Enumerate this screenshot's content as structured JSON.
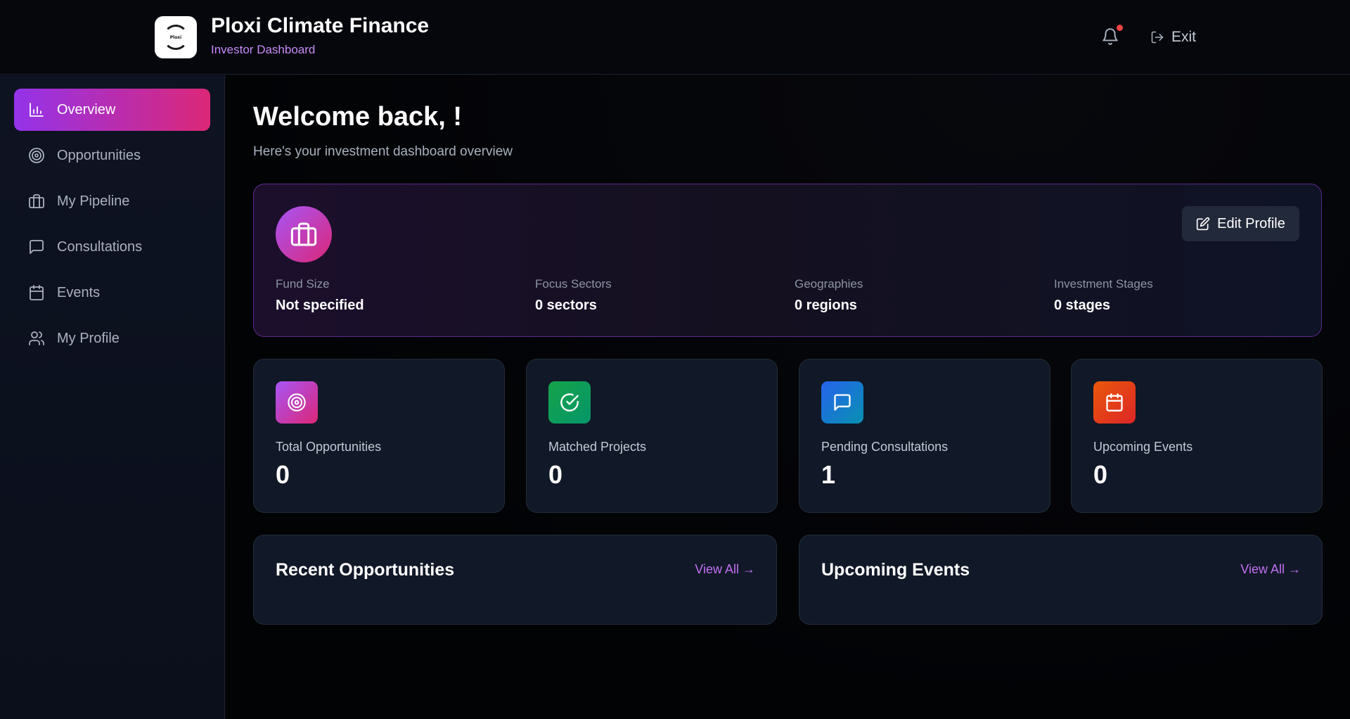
{
  "header": {
    "logo_text": "Ploxi",
    "title": "Ploxi Climate Finance",
    "subtitle": "Investor Dashboard",
    "notification_icon": "bell-icon",
    "exit_label": "Exit"
  },
  "sidebar": {
    "items": [
      {
        "label": "Overview",
        "icon": "bar-chart-icon",
        "active": true
      },
      {
        "label": "Opportunities",
        "icon": "target-icon"
      },
      {
        "label": "My Pipeline",
        "icon": "briefcase-icon"
      },
      {
        "label": "Consultations",
        "icon": "message-square-icon"
      },
      {
        "label": "Events",
        "icon": "calendar-icon"
      },
      {
        "label": "My Profile",
        "icon": "users-icon"
      }
    ]
  },
  "main": {
    "welcome": "Welcome back, !",
    "welcome_sub": "Here's your investment dashboard overview",
    "profile": {
      "edit_label": "Edit Profile",
      "stats": [
        {
          "label": "Fund Size",
          "value": "Not specified"
        },
        {
          "label": "Focus Sectors",
          "value": "0 sectors"
        },
        {
          "label": "Geographies",
          "value": "0 regions"
        },
        {
          "label": "Investment Stages",
          "value": "0 stages"
        }
      ]
    },
    "metrics": [
      {
        "label": "Total Opportunities",
        "value": "0",
        "icon": "target-icon",
        "color_from": "#a855f7",
        "color_to": "#db2777"
      },
      {
        "label": "Matched Projects",
        "value": "0",
        "icon": "check-circle-icon",
        "color_from": "#16a34a",
        "color_to": "#059669"
      },
      {
        "label": "Pending Consultations",
        "value": "1",
        "icon": "message-square-icon",
        "color_from": "#2563eb",
        "color_to": "#0891b2"
      },
      {
        "label": "Upcoming Events",
        "value": "0",
        "icon": "calendar-icon",
        "color_from": "#ea580c",
        "color_to": "#dc2626"
      }
    ],
    "sections": [
      {
        "title": "Recent Opportunities",
        "link": "View All →"
      },
      {
        "title": "Upcoming Events",
        "link": "View All →"
      }
    ]
  }
}
